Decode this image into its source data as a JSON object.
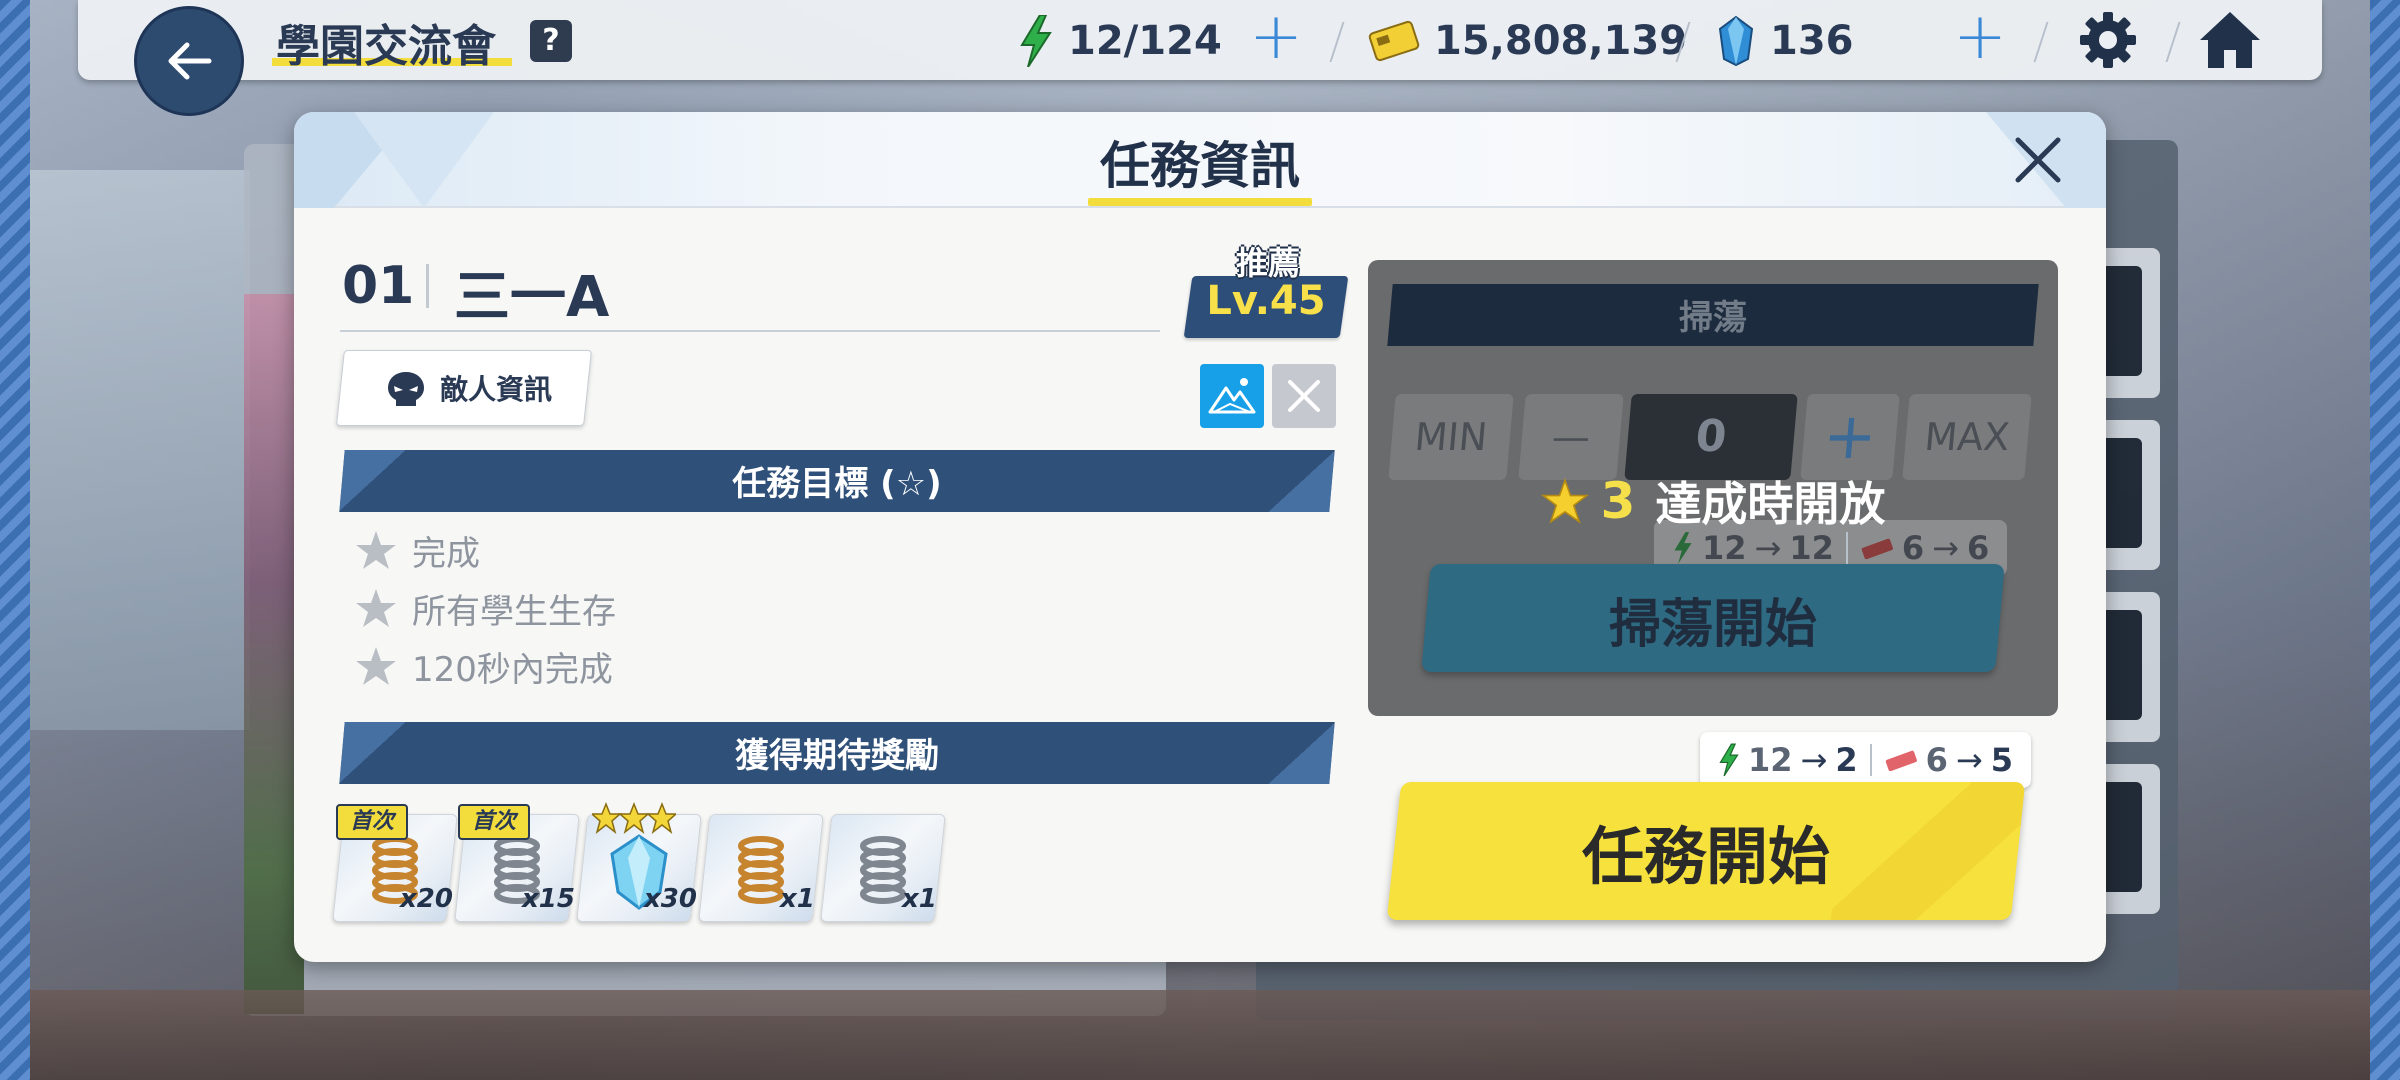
{
  "topbar": {
    "title": "學園交流會",
    "help_label": "?",
    "ap": "12/124",
    "credits": "15,808,139",
    "gems": "136",
    "plus": "+"
  },
  "modal": {
    "title": "任務資訊",
    "stage_number": "01",
    "stage_name": "三一A",
    "recommend_label": "推薦",
    "recommend_level": "Lv.45",
    "enemy_info_label": "敵人資訊",
    "objectives_title": "任務目標 (☆)",
    "objectives": [
      "完成",
      "所有學生生存",
      "120秒內完成"
    ],
    "rewards_title": "獲得期待獎勵",
    "rewards": [
      {
        "qty": "x20",
        "tag": "首次",
        "icon": "gold-spring-icon"
      },
      {
        "qty": "x15",
        "tag": "首次",
        "icon": "silver-spring-icon"
      },
      {
        "qty": "x30",
        "tag": "",
        "icon": "blue-crystal-icon",
        "stars": 3
      },
      {
        "qty": "x1",
        "tag": "",
        "icon": "gold-spring-icon"
      },
      {
        "qty": "x1",
        "tag": "",
        "icon": "silver-spring-icon"
      }
    ]
  },
  "sweep": {
    "title": "掃蕩",
    "min_label": "MIN",
    "minus_label": "—",
    "count": "0",
    "plus_label": "+",
    "max_label": "MAX",
    "lock_stars": "3",
    "lock_text": "達成時開放",
    "cost_ap_from": "12",
    "cost_ap_to": "12",
    "cost_ticket_from": "6",
    "cost_ticket_to": "6",
    "start_label": "掃蕩開始"
  },
  "start": {
    "cost_ap_from": "12",
    "cost_ap_to": "2",
    "cost_ticket_from": "6",
    "cost_ticket_to": "5",
    "label": "任務開始",
    "arrow": "→"
  },
  "colors": {
    "accent_yellow": "#f6e13d",
    "navy": "#2f5079",
    "sky": "#17a0e8"
  }
}
